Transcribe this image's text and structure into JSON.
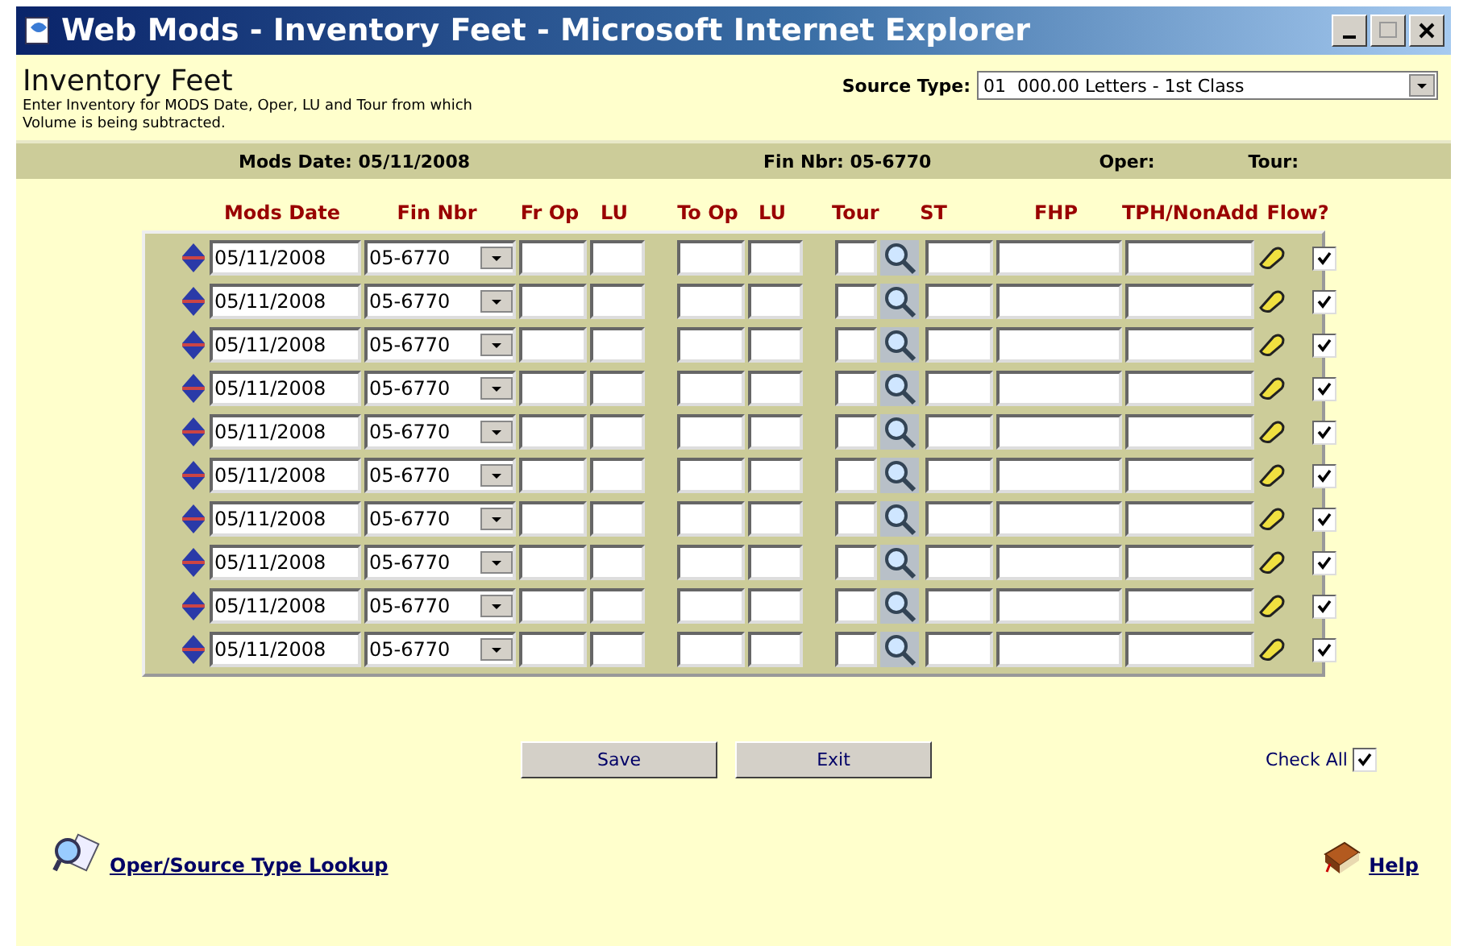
{
  "window": {
    "title": "Web Mods - Inventory Feet - Microsoft Internet Explorer"
  },
  "page": {
    "title": "Inventory Feet",
    "description": "Enter Inventory for MODS Date, Oper, LU and Tour from which Volume is being subtracted."
  },
  "source_type": {
    "label": "Source Type:",
    "value": "01  000.00 Letters - 1st Class"
  },
  "info_bar": [
    "Mods Date: 05/11/2008",
    "Fin Nbr: 05-6770",
    "Oper:",
    "Tour:"
  ],
  "columns": [
    "Mods Date",
    "Fin Nbr",
    "Fr Op",
    "LU",
    "To Op",
    "LU",
    "Tour",
    "ST",
    "FHP",
    "TPH/NonAdd",
    "Flow?"
  ],
  "rows": [
    {
      "mods_date": "05/11/2008",
      "fin_nbr": "05-6770",
      "flow": true
    },
    {
      "mods_date": "05/11/2008",
      "fin_nbr": "05-6770",
      "flow": true
    },
    {
      "mods_date": "05/11/2008",
      "fin_nbr": "05-6770",
      "flow": true
    },
    {
      "mods_date": "05/11/2008",
      "fin_nbr": "05-6770",
      "flow": true
    },
    {
      "mods_date": "05/11/2008",
      "fin_nbr": "05-6770",
      "flow": true
    },
    {
      "mods_date": "05/11/2008",
      "fin_nbr": "05-6770",
      "flow": true
    },
    {
      "mods_date": "05/11/2008",
      "fin_nbr": "05-6770",
      "flow": true
    },
    {
      "mods_date": "05/11/2008",
      "fin_nbr": "05-6770",
      "flow": true
    },
    {
      "mods_date": "05/11/2008",
      "fin_nbr": "05-6770",
      "flow": true
    },
    {
      "mods_date": "05/11/2008",
      "fin_nbr": "05-6770",
      "flow": true
    }
  ],
  "buttons": [
    "Save",
    "Exit"
  ],
  "check_all": {
    "label": "Check All",
    "checked": true
  },
  "links": {
    "lookup": "Oper/Source Type Lookup",
    "help": "Help"
  }
}
